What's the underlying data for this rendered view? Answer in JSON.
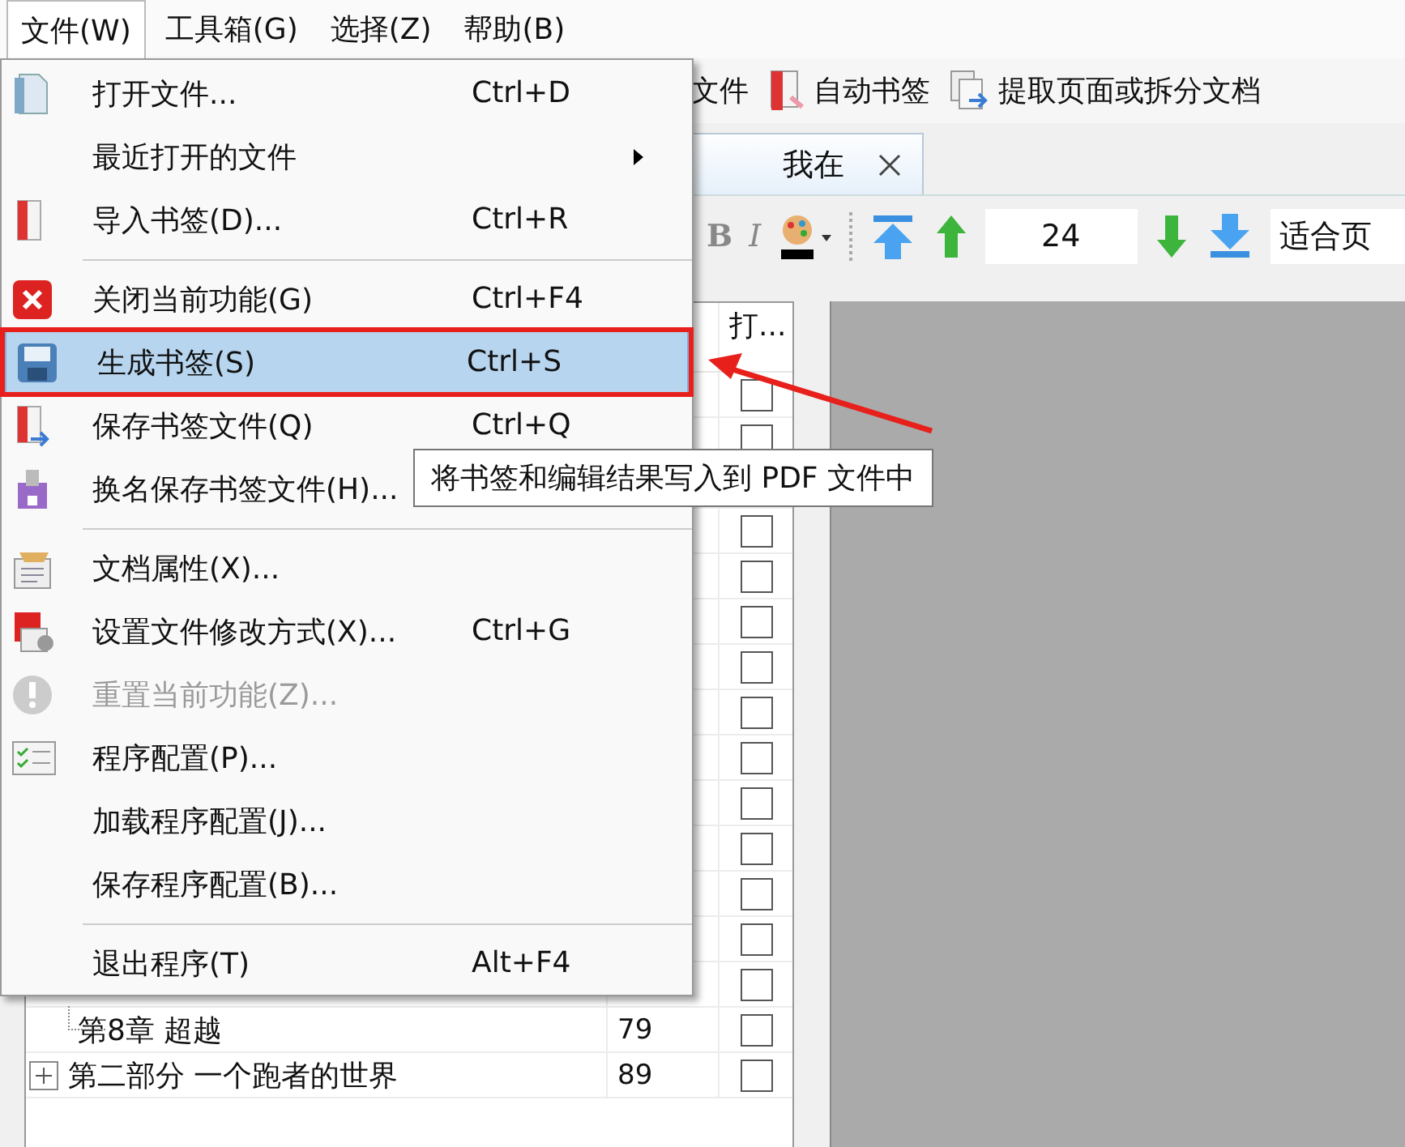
{
  "menubar": [
    {
      "label": "文件(W)",
      "selected": true
    },
    {
      "label": "工具箱(G)",
      "selected": false
    },
    {
      "label": "选择(Z)",
      "selected": false
    },
    {
      "label": "帮助(B)",
      "selected": false
    }
  ],
  "toolbar": [
    {
      "label": "文件"
    },
    {
      "label": "自动书签"
    },
    {
      "label": "提取页面或拆分文档"
    }
  ],
  "tab": {
    "title": "我在"
  },
  "format_bar": {
    "bold": "B",
    "italic": "I",
    "page_number": "24",
    "zoom": "适合页"
  },
  "bookmark_tree": {
    "check_header": "打...",
    "rows": [
      {
        "kind": "bookmark",
        "checked": false,
        "children": [
          {
            "kind": "bookmark",
            "checked": false
          },
          {
            "kind": "bookmark"
          },
          {
            "kind": "bookmark",
            "checked": false
          },
          {
            "kind": "bookmark",
            "checked": false
          },
          {
            "kind": "bookmark",
            "checked": false
          },
          {
            "kind": "bookmark",
            "checked": false
          },
          {
            "kind": "bookmark",
            "checked": false
          },
          {
            "kind": "bookmark",
            "checked": false
          },
          {
            "kind": "bookmark",
            "checked": false
          },
          {
            "kind": "bookmark",
            "checked": false
          },
          {
            "kind": "bookmark",
            "checked": false
          },
          {
            "kind": "bookmark",
            "checked": false
          },
          {
            "kind": "bookmark",
            "checked": false
          },
          {
            "kind": "bookmark",
            "name": "第8章  超越",
            "page": "79",
            "checked": false
          }
        ]
      },
      {
        "kind": "bookmark",
        "name": "第二部分  一个跑者的世界",
        "page": "89",
        "checked": false,
        "expanded": false
      }
    ]
  },
  "menu": [
    {
      "kind": "item",
      "label": "打开文件...",
      "shortcut": "Ctrl+D",
      "selected": false,
      "disabled": false
    },
    {
      "kind": "submenu",
      "label": "最近打开的文件",
      "selected": false,
      "disabled": false
    },
    {
      "kind": "item",
      "label": "导入书签(D)...",
      "shortcut": "Ctrl+R",
      "selected": false,
      "disabled": false
    },
    {
      "kind": "separator"
    },
    {
      "kind": "item",
      "label": "关闭当前功能(G)",
      "shortcut": "Ctrl+F4",
      "selected": false,
      "disabled": false
    },
    {
      "kind": "item",
      "label": "生成书签(S)",
      "shortcut": "Ctrl+S",
      "selected": true,
      "disabled": false
    },
    {
      "kind": "item",
      "label": "保存书签文件(Q)",
      "shortcut": "Ctrl+Q",
      "selected": false,
      "disabled": false
    },
    {
      "kind": "item",
      "label": "换名保存书签文件(H)...",
      "selected": false,
      "disabled": false
    },
    {
      "kind": "separator"
    },
    {
      "kind": "item",
      "label": "文档属性(X)...",
      "selected": false,
      "disabled": false
    },
    {
      "kind": "item",
      "label": "设置文件修改方式(X)...",
      "shortcut": "Ctrl+G",
      "selected": false,
      "disabled": false
    },
    {
      "kind": "item",
      "label": "重置当前功能(Z)...",
      "selected": false,
      "disabled": true
    },
    {
      "kind": "item",
      "label": "程序配置(P)...",
      "selected": false,
      "disabled": false
    },
    {
      "kind": "item",
      "label": "加载程序配置(J)...",
      "selected": false,
      "disabled": false
    },
    {
      "kind": "item",
      "label": "保存程序配置(B)...",
      "selected": false,
      "disabled": false
    },
    {
      "kind": "separator"
    },
    {
      "kind": "item",
      "label": "退出程序(T)",
      "shortcut": "Alt+F4",
      "selected": false,
      "disabled": false
    }
  ],
  "tooltip": "将书签和编辑结果写入到 PDF 文件中"
}
